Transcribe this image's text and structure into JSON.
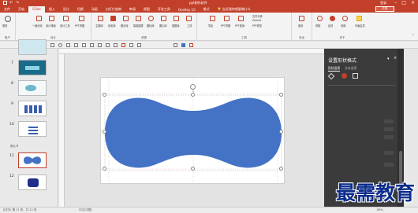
{
  "titlebar": {
    "title": "ppt制作软件",
    "account": "登录",
    "share": "共享"
  },
  "tabs": [
    {
      "label": "文件"
    },
    {
      "label": "开始"
    },
    {
      "label": "iSlide"
    },
    {
      "label": "插入"
    },
    {
      "label": "设计"
    },
    {
      "label": "切换"
    },
    {
      "label": "动画"
    },
    {
      "label": "幻灯片放映"
    },
    {
      "label": "审阅"
    },
    {
      "label": "视图"
    },
    {
      "label": "开发工具"
    },
    {
      "label": "OneKey 10"
    },
    {
      "label": "格式"
    },
    {
      "label": "告诉我你想要做什么"
    }
  ],
  "ribbon_groups": [
    {
      "label": "账户"
    },
    {
      "label": "设计"
    },
    {
      "label": "资源"
    },
    {
      "label": "工具"
    },
    {
      "label": "安全"
    },
    {
      "label": "关于"
    }
  ],
  "ribbon_items": [
    {
      "label": "一键优化"
    },
    {
      "label": "设计排版"
    },
    {
      "label": "设计工具"
    },
    {
      "label": "PPT拼图"
    },
    {
      "label": "主题库"
    },
    {
      "label": "色彩库"
    },
    {
      "label": "图示库"
    },
    {
      "label": "智能图表"
    },
    {
      "label": "图标库"
    },
    {
      "label": "图片库"
    },
    {
      "label": "插图库"
    },
    {
      "label": "工具"
    },
    {
      "label": "导出"
    },
    {
      "label": "PPT拼图"
    },
    {
      "label": "PPT瘦身"
    },
    {
      "label": "文件分析"
    },
    {
      "label": "ZoomIt"
    },
    {
      "label": "PPT修复"
    },
    {
      "label": "原创"
    },
    {
      "label": "帮助"
    },
    {
      "label": "反馈"
    },
    {
      "label": "设置"
    },
    {
      "label": "升级会员"
    }
  ],
  "thumbnails": [
    {
      "num": "7"
    },
    {
      "num": "8"
    },
    {
      "num": "9"
    },
    {
      "num": "10"
    },
    {
      "num": "11"
    },
    {
      "num": "12"
    }
  ],
  "section": "默认节",
  "right_panel": {
    "title": "设置形状格式",
    "tab_shape": "形状选项",
    "tab_text": "文本选项"
  },
  "status": {
    "slide_info": "幻灯片 第 11 张，共 12 张",
    "language": "中文(中国)",
    "zoom": "86%"
  },
  "shape": {
    "fill_color": "#4472c4"
  },
  "watermark": "最需教育"
}
